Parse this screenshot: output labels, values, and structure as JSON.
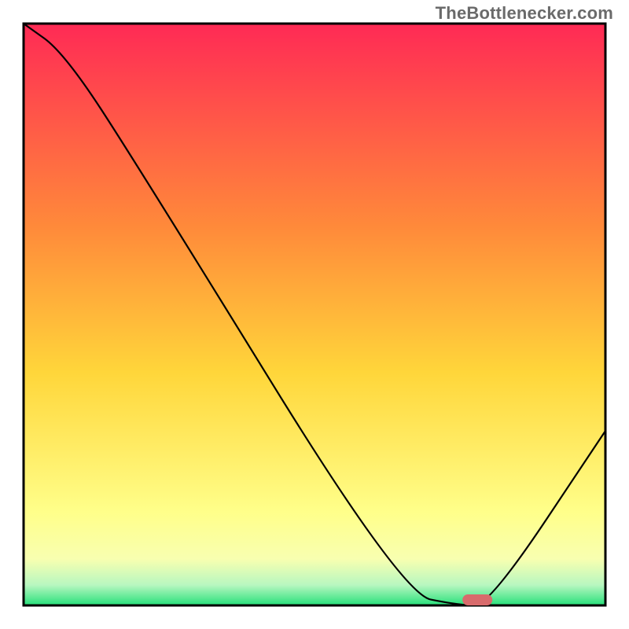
{
  "watermark": {
    "text": "TheBottlenecker.com"
  },
  "chart_data": {
    "type": "line",
    "title": "",
    "xlabel": "",
    "ylabel": "",
    "xlim": [
      0,
      100
    ],
    "ylim": [
      0,
      100
    ],
    "grid": false,
    "background": "spectral-vertical-red-to-green",
    "series": [
      {
        "name": "bottleneck-curve",
        "x": [
          0,
          7,
          20,
          65,
          75,
          80,
          100
        ],
        "values": [
          100,
          95,
          75,
          2,
          0,
          0,
          30
        ]
      }
    ],
    "marker": {
      "name": "selected-point",
      "x": 78,
      "y": 0,
      "shape": "pill",
      "color": "#d86b6c"
    },
    "background_stops": [
      {
        "offset": 0.0,
        "color": "#ff2a55"
      },
      {
        "offset": 0.35,
        "color": "#ff8a3a"
      },
      {
        "offset": 0.6,
        "color": "#ffd63a"
      },
      {
        "offset": 0.84,
        "color": "#ffff8a"
      },
      {
        "offset": 0.92,
        "color": "#f8ffb0"
      },
      {
        "offset": 0.965,
        "color": "#b8f7c0"
      },
      {
        "offset": 1.0,
        "color": "#26e07a"
      }
    ]
  }
}
